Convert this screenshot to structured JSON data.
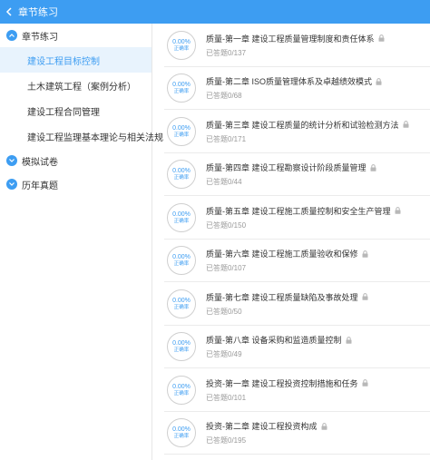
{
  "header": {
    "title": "章节练习"
  },
  "colors": {
    "accent": "#3d9df2",
    "active_bg": "#e8f3fd"
  },
  "sidebar": {
    "categories": [
      {
        "label": "章节练习",
        "expanded": true
      },
      {
        "label": "模拟试卷",
        "expanded": false
      },
      {
        "label": "历年真题",
        "expanded": false
      }
    ],
    "items": [
      {
        "label": "建设工程目标控制",
        "active": true
      },
      {
        "label": "土木建筑工程（案例分析）"
      },
      {
        "label": "建设工程合同管理"
      },
      {
        "label": "建设工程监理基本理论与相关法规"
      }
    ]
  },
  "chapters": [
    {
      "title": "质量-第一章 建设工程质量管理制度和责任体系",
      "progress": "已答题0/137",
      "rate": "0.00%",
      "rate_label": "正确率"
    },
    {
      "title": "质量-第二章 ISO质量管理体系及卓越绩效模式",
      "progress": "已答题0/68",
      "rate": "0.00%",
      "rate_label": "正确率"
    },
    {
      "title": "质量-第三章 建设工程质量的统计分析和试验检测方法",
      "progress": "已答题0/171",
      "rate": "0.00%",
      "rate_label": "正确率"
    },
    {
      "title": "质量-第四章 建设工程勘察设计阶段质量管理",
      "progress": "已答题0/44",
      "rate": "0.00%",
      "rate_label": "正确率"
    },
    {
      "title": "质量-第五章 建设工程施工质量控制和安全生产管理",
      "progress": "已答题0/150",
      "rate": "0.00%",
      "rate_label": "正确率"
    },
    {
      "title": "质量-第六章 建设工程施工质量验收和保修",
      "progress": "已答题0/107",
      "rate": "0.00%",
      "rate_label": "正确率"
    },
    {
      "title": "质量-第七章 建设工程质量缺陷及事故处理",
      "progress": "已答题0/50",
      "rate": "0.00%",
      "rate_label": "正确率"
    },
    {
      "title": "质量-第八章 设备采购和监造质量控制",
      "progress": "已答题0/49",
      "rate": "0.00%",
      "rate_label": "正确率"
    },
    {
      "title": "投资-第一章 建设工程投资控制措施和任务",
      "progress": "已答题0/101",
      "rate": "0.00%",
      "rate_label": "正确率"
    },
    {
      "title": "投资-第二章 建设工程投资构成",
      "progress": "已答题0/195",
      "rate": "0.00%",
      "rate_label": "正确率"
    }
  ]
}
